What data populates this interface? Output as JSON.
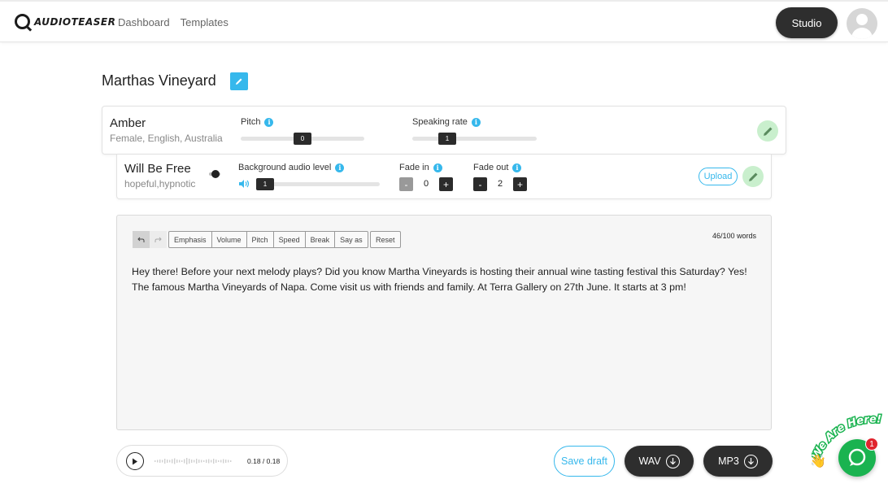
{
  "header": {
    "logo_text": "AUDIOTEASER",
    "nav": [
      "Dashboard",
      "Templates"
    ],
    "studio_label": "Studio"
  },
  "project": {
    "title": "Marthas Vineyard"
  },
  "voice": {
    "name": "Amber",
    "description": "Female, English, Australia",
    "pitch_label": "Pitch",
    "pitch_value": "0",
    "pitch_level": 0.5,
    "rate_label": "Speaking rate",
    "rate_value": "1",
    "rate_level": 0.28
  },
  "music": {
    "name": "Will Be Free",
    "tags": "hopeful,hypnotic",
    "bg_label": "Background audio level",
    "bg_value": "1",
    "fadein_label": "Fade in",
    "fadein_value": "0",
    "fadeout_label": "Fade out",
    "fadeout_value": "2",
    "upload_label": "Upload",
    "minus": "-",
    "plus": "+"
  },
  "editor": {
    "tools": [
      "Emphasis",
      "Volume",
      "Pitch",
      "Speed",
      "Break",
      "Say as"
    ],
    "reset_label": "Reset",
    "word_count": "46/100 words",
    "text": "Hey there! Before your next melody plays? Did you know Martha Vineyards is hosting their annual wine tasting festival this Saturday? Yes! The famous Martha Vineyards of Napa. Come visit us with friends and family. At Terra Gallery on 27th June. It starts at 3 pm!"
  },
  "player": {
    "time": "0.18 / 0.18"
  },
  "actions": {
    "save_label": "Save draft",
    "wav_label": "WAV",
    "mp3_label": "MP3"
  },
  "chat": {
    "banner": "We Are Here!",
    "badge": "1"
  },
  "colors": {
    "accent": "#36b8ec",
    "dark_button": "#2e2e2e",
    "edit_green": "#c9efcd",
    "chat_green": "#1ab350",
    "badge_red": "#e0242d"
  }
}
